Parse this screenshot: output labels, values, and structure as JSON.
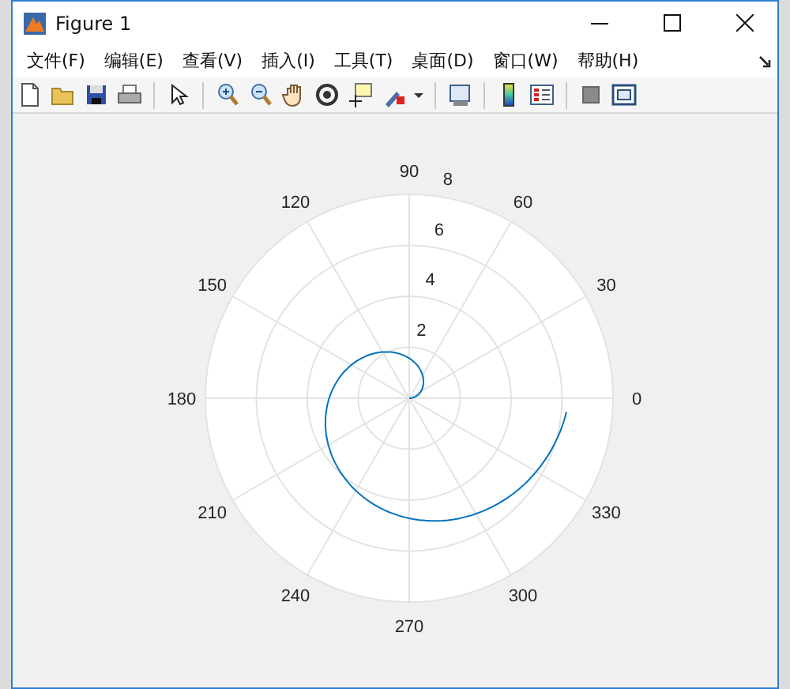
{
  "window": {
    "title": "Figure 1"
  },
  "menu": [
    "文件(F)",
    "编辑(E)",
    "查看(V)",
    "插入(I)",
    "工具(T)",
    "桌面(D)",
    "窗口(W)",
    "帮助(H)"
  ],
  "polar_plot": {
    "angle_labels": [
      "0",
      "30",
      "60",
      "90",
      "120",
      "150",
      "180",
      "210",
      "240",
      "270",
      "300",
      "330"
    ],
    "radius_labels": [
      "2",
      "4",
      "6",
      "8"
    ]
  }
}
